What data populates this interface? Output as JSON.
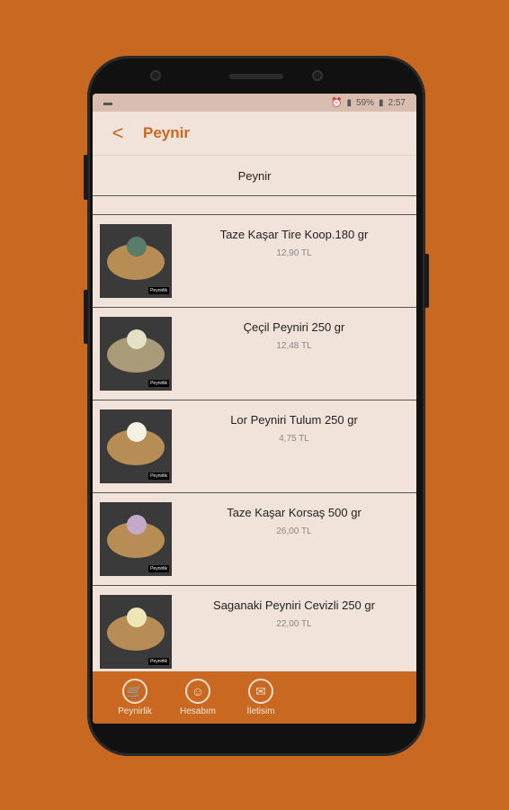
{
  "statusbar": {
    "time": "2:57",
    "battery": "59%"
  },
  "appbar": {
    "back_glyph": "<",
    "title": "Peynir"
  },
  "category_label": "Peynir",
  "products": [
    {
      "name": "Taze Kaşar Tire Koop.180 gr",
      "price": "12,90 TL"
    },
    {
      "name": "Çeçil Peyniri 250 gr",
      "price": "12,48 TL"
    },
    {
      "name": "Lor Peyniri Tulum 250 gr",
      "price": "4,75 TL"
    },
    {
      "name": "Taze Kaşar Korsaş 500 gr",
      "price": "26,00 TL"
    },
    {
      "name": "Saganaki Peyniri Cevizli 250 gr",
      "price": "22,00 TL"
    }
  ],
  "thumb_tag": "Peynirlik",
  "bottom_nav": [
    {
      "label": "Peynirlik",
      "icon": "cart-icon"
    },
    {
      "label": "Hesabım",
      "icon": "user-icon"
    },
    {
      "label": "İletisim",
      "icon": "mail-icon"
    }
  ],
  "colors": {
    "accent": "#c96821",
    "screen_bg": "#f2e3da"
  }
}
